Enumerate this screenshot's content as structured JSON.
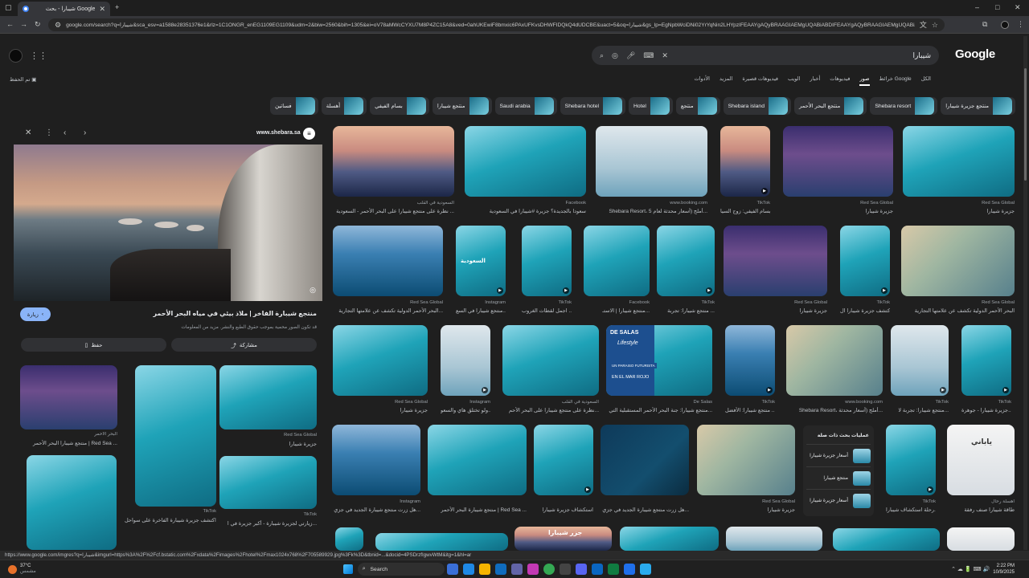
{
  "browser": {
    "tab_title": "شيبارا - بحث Google",
    "url": "google.com/search?q=شيبارا&sca_esv=a1588e28351376e1&rlz=1C1ONGR_enEG1109EG1109&udm=2&biw=2560&bih=1305&ei=oV78aMWcCYXU7M8P4ZC15A8&ved=0ahUKEwiF8bmxic6PAxUFKvsDHWFIDQkQ4dUDCBE&uact=5&oq=شيبارا&gs_lp=EgNpbWciDNi02YrYqNin2LHYpzIFEAAYgAQyBRAAGIAEMgUQABiABDIFEAAYgAQyBRAAGIAEMgUQABiABDIFEAAYgAQyBRAAGIAEMgUQABiAB..."
  },
  "google": {
    "logo": "Google",
    "query": "شيبارا",
    "nav": [
      "الكل",
      "خرائط Google",
      "صور",
      "فيديوهات",
      "أخبار",
      "الويب",
      "فيديوهات قصيرة",
      "المزيد",
      "الأدوات"
    ],
    "saved": "تم الحفظ"
  },
  "chips": [
    "منتجع جزيرة شيبارا",
    "Shebara resort",
    "منتجع البحر الأحمر",
    "Shebara island",
    "منتجع",
    "Hotel",
    "Shebara hotel",
    "Saudi arabia",
    "منتجع شيبارا",
    "بسام الفيفي",
    "أهسلة",
    "فساتين"
  ],
  "panel": {
    "site": "www.shebara.sa",
    "title": "منتجع شيبارة الفاخر | ملاذ بيئي في مياه البحر الأحمر",
    "note": "قد تكون الصور محمية بموجب حقوق الطبع والنشر. مزيد من المعلومات",
    "visit": "زيارة",
    "share": "مشاركة",
    "save": "حفظ",
    "related": [
      {
        "title": "منتجع شيبارا البحر الأحمر | Red Sea ...",
        "src": "البحر الأحمر"
      },
      {
        "title": "جزيرة شيبارا",
        "src": "Red Sea Global"
      },
      {
        "title": "اكتشف جزيرة شيبارة الفاخرة على سواحل...",
        "src": "TikTok"
      },
      {
        "title": "زيارتي لجزيرة شيبارة - أكبر جزيرة في ا...",
        "src": "TikTok"
      }
    ]
  },
  "grid": [
    {
      "src": "السعودية في القلب",
      "cap": "نظرة على منتجع شيبارا على البحر الأحمر - السعودية ..."
    },
    {
      "src": "Facebook",
      "cap": "سعودا بالجديدة؟ جزيرة #شيبارا في السعودية"
    },
    {
      "src": "www.booking.com",
      "cap": "Shebara Resort، أملج (أسعار محدثة لعام 5..."
    },
    {
      "src": "TikTok",
      "cap": "بسام الفيفي: زوج السيا..."
    },
    {
      "src": "Red Sea Global",
      "cap": "جزيرة شيبارا"
    },
    {
      "src": "Red Sea Global",
      "cap": "جزيرة شيبارا"
    },
    {
      "src": "Red Sea Global",
      "cap": "البحر الأحمر الدولية تكشف عن علامتها التجارية..."
    },
    {
      "src": "Instagram",
      "cap": "منتجع شيبارا في السع..."
    },
    {
      "src": "TikTok",
      "cap": "اجمل لقطات الغروب ..."
    },
    {
      "src": "Facebook",
      "cap": "منتجع شيبارا | الاستـ..."
    },
    {
      "src": "TikTok",
      "cap": "منتجع شيبارا: تجربة ..."
    },
    {
      "src": "Red Sea Global",
      "cap": "جزيرة شيبارا"
    },
    {
      "src": "TikTok",
      "cap": "اكتشف جزيرة شيبارا ال..."
    },
    {
      "src": "Red Sea Global",
      "cap": "البحر الأحمر الدولية تكشف عن علامتها التجارية"
    },
    {
      "src": "Red Sea Global",
      "cap": "جزيرة شيبارا"
    },
    {
      "src": "Instagram",
      "cap": "ولو تختلق هاي والسعو..."
    },
    {
      "src": "السعودية في القلب",
      "cap": "نظرة على منتجع شيبارا على البحر الأحم..."
    },
    {
      "src": "De Salas",
      "cap": "منتجع شيبارا: جنة البحر الأحمر المستقبلية التي..."
    },
    {
      "src": "TikTok",
      "cap": "منتجع شيبارا: الأفضل ..."
    },
    {
      "src": "www.booking.com",
      "cap": "Shebara Resort، أملج (أسعار محدثة..."
    },
    {
      "src": "TikTok",
      "cap": "منتجع شيبارا: تجربة لا..."
    },
    {
      "src": "TikTok",
      "cap": "جزيرة شيبارا - جوهرة..."
    },
    {
      "src": "Instagram",
      "cap": "هل زرت منتجع شيبارة الجديد في جزي..."
    },
    {
      "src": "",
      "cap": "منتجع شيبارة البحر الأحمر | Red Sea ..."
    },
    {
      "src": "",
      "cap": "استكشاف جزيرة شيبارا"
    },
    {
      "src": "",
      "cap": "هل زرت منتجع شيبارة الجديد في جزي..."
    },
    {
      "src": "Red Sea Global",
      "cap": "جزيرة شيبارا"
    },
    {
      "src": "TikTok",
      "cap": "رحلة استكشاف شيبارا..."
    },
    {
      "src": "أهسلة رحال",
      "cap": "طاقة شيبارا صنف رفقة"
    }
  ],
  "overlay_text": {
    "desalas_brand": "DE SALAS",
    "desalas_sub": "Lifestyle",
    "desalas_l1": "UN PARAISO FUTURISTA",
    "desalas_l2": "EN EL MAR ROJO",
    "badge_saudi": "السعودية",
    "badge_jazeera": "جزر شيبارا",
    "ad": "ياباني"
  },
  "related_searches": {
    "title": "عمليات بحث ذات صلة",
    "items": [
      "أسعار جزيرة شيبارا",
      "منتجع شيبارا",
      "أسعار جزيرة شيبارا"
    ]
  },
  "status_url": "https://www.google.com/imgres?q=شيبارا&imgurl=https%3A%2F%2Fcf.bstatic.com%2Fxdata%2Fimages%2Fhotel%2Fmax1024x768%2F705589929.jpg%3Fk%3D&tbnid=...&docid=4PSDrzfIgwvWtM&itg=1&hl=ar",
  "taskbar": {
    "weather": "37°C",
    "weather_sub": "مشمس",
    "search": "Search",
    "time": "2:22 PM",
    "date": "10/9/2025"
  }
}
